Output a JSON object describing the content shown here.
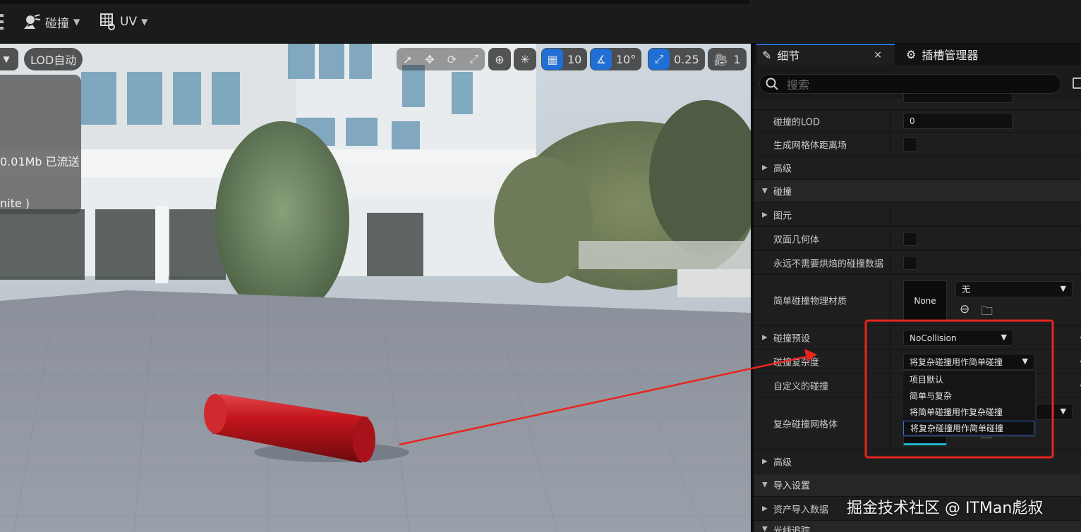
{
  "toolbar": {
    "collision_label": "碰撞",
    "uv_label": "UV"
  },
  "viewport": {
    "lod_label": "LOD自动",
    "info_text_1": "0.01Mb 已流送",
    "info_text_2": "nite )",
    "grid_snap_value": "10",
    "rotate_snap_value": "10°",
    "scale_snap_value": "0.25",
    "camera_speed_value": "1"
  },
  "panel": {
    "tabs": [
      {
        "label": "细节",
        "close": "×"
      },
      {
        "label": "插槽管理器"
      }
    ],
    "search_placeholder": "搜索",
    "rows": {
      "collision_lod": {
        "label": "碰撞的LOD",
        "value": "0"
      },
      "gen_distance_field": {
        "label": "生成网格体距离场"
      },
      "advanced_1": {
        "label": "高级"
      },
      "collision_cat": {
        "label": "碰撞"
      },
      "primitives": {
        "label": "图元"
      },
      "double_sided": {
        "label": "双面几何体"
      },
      "never_cook": {
        "label": "永远不需要烘焙的碰撞数据"
      },
      "simple_phys_mat": {
        "label": "简单碰撞物理材质",
        "thumb": "None",
        "value": "无"
      },
      "collision_preset": {
        "label": "碰撞预设",
        "value": "NoCollision"
      },
      "collision_complexity": {
        "label": "碰撞复杂度",
        "value": "将复杂碰撞用作简单碰撞"
      },
      "custom_collision": {
        "label": "自定义的碰撞"
      },
      "complex_collision_mesh": {
        "label": "复杂碰撞网格体"
      },
      "advanced_2": {
        "label": "高级"
      },
      "import_settings": {
        "label": "导入设置"
      },
      "asset_import_data": {
        "label": "资产导入数据"
      },
      "raytracing": {
        "label": "光线追踪"
      }
    },
    "dropdown_options": [
      "项目默认",
      "简单与复杂",
      "将简单碰撞用作复杂碰撞",
      "将复杂碰撞用作简单碰撞"
    ]
  },
  "watermark": "掘金技术社区 @ ITMan彪叔",
  "colors": {
    "accent_blue": "#2e73d3",
    "annotation_red": "#e8251f",
    "cylinder_red": "#c4161c"
  },
  "icons": {
    "collision": "collision-icon",
    "uv": "uv-grid-icon",
    "details": "pencil-icon",
    "sockets": "socket-manager-icon",
    "search": "search-icon"
  }
}
